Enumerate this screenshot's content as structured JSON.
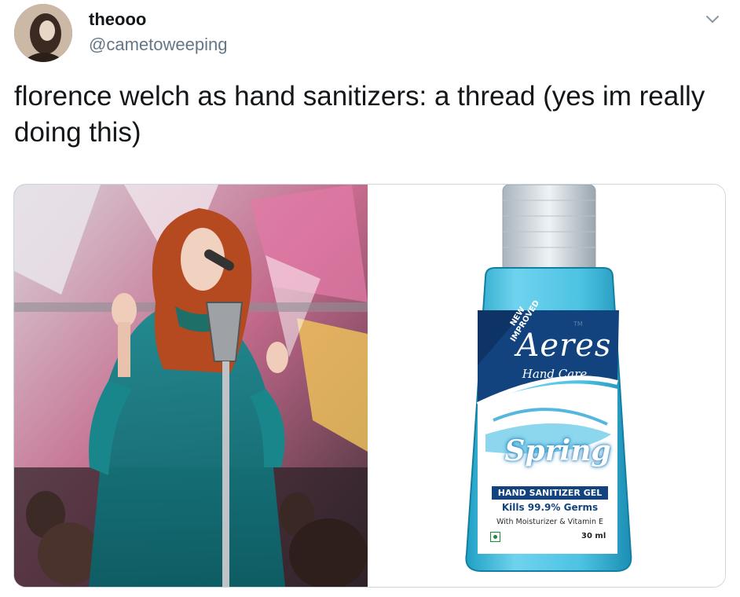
{
  "tweet": {
    "display_name": "theooo",
    "handle": "@cametoweeping",
    "text": "florence welch as hand sanitizers: a thread (yes im really doing this)"
  },
  "product": {
    "badge": "NEW IMPROVED",
    "trademark": "TM",
    "brand": "Aeres",
    "sub_brand": "Hand Care",
    "variant": "Spring",
    "product_type": "HAND SANITIZER GEL",
    "claim": "Kills 99.9% Germs",
    "features": "With Moisturizer & Vitamin E",
    "volume": "30 ml"
  },
  "icons": {
    "menu": "chevron-down-icon"
  },
  "colors": {
    "teal_dress": "#0f6f76",
    "gel_blue": "#3fb7d8",
    "label_navy": "#13437e"
  }
}
